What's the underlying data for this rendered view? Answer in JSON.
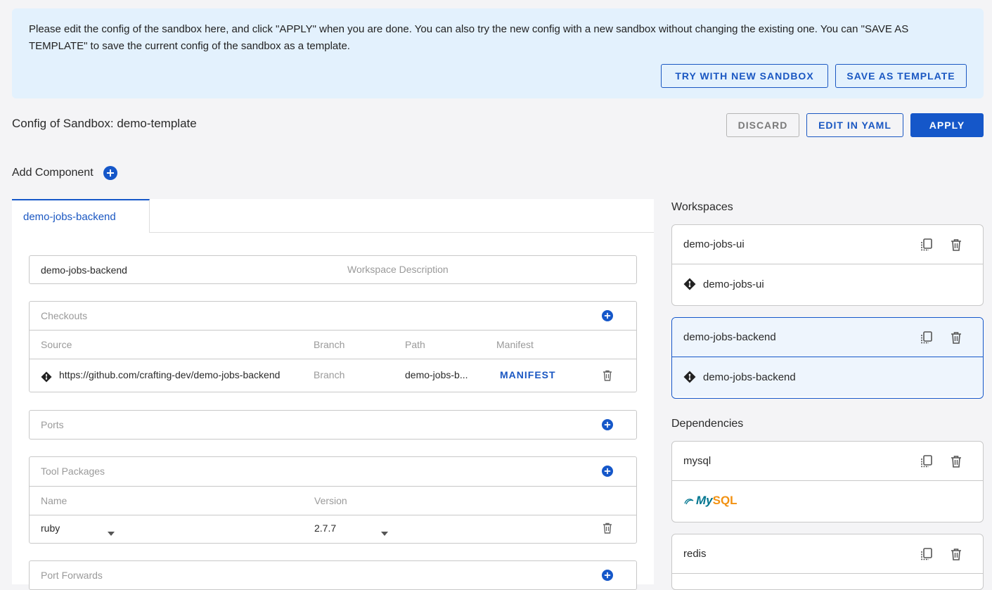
{
  "banner": {
    "text": "Please edit the config of the sandbox here, and click \"APPLY\" when you are done. You can also try the new config with a new sandbox without changing the existing one. You can \"SAVE AS TEMPLATE\" to save the current config of the sandbox as a template.",
    "try_btn": "TRY WITH NEW SANDBOX",
    "save_btn": "SAVE AS TEMPLATE"
  },
  "header": {
    "title": "Config of Sandbox: demo-template",
    "discard": "DISCARD",
    "edit_yaml": "EDIT IN YAML",
    "apply": "APPLY"
  },
  "add_component": "Add Component",
  "tab": {
    "label": "demo-jobs-backend"
  },
  "workspace": {
    "name_value": "demo-jobs-backend",
    "description_placeholder": "Workspace Description"
  },
  "checkouts": {
    "title": "Checkouts",
    "columns": [
      "Source",
      "Branch",
      "Path",
      "Manifest"
    ],
    "row": {
      "source": "https://github.com/crafting-dev/demo-jobs-backend",
      "branch_placeholder": "Branch",
      "path": "demo-jobs-b...",
      "manifest": "MANIFEST"
    }
  },
  "ports": {
    "title": "Ports"
  },
  "tool_packages": {
    "title": "Tool Packages",
    "columns": [
      "Name",
      "Version"
    ],
    "row": {
      "name": "ruby",
      "version": "2.7.7"
    }
  },
  "port_forwards": {
    "title": "Port Forwards"
  },
  "right": {
    "workspaces_title": "Workspaces",
    "workspaces": [
      {
        "name": "demo-jobs-ui",
        "repo": "demo-jobs-ui"
      },
      {
        "name": "demo-jobs-backend",
        "repo": "demo-jobs-backend"
      }
    ],
    "dependencies_title": "Dependencies",
    "dependencies": [
      {
        "name": "mysql",
        "logo": "MySQL"
      },
      {
        "name": "redis"
      }
    ]
  },
  "colors": {
    "accent": "#1557c9",
    "banner_bg": "#e3f1fd",
    "mysql_blue": "#00758f",
    "mysql_orange": "#f29111"
  },
  "icons": {
    "plus": "plus-circle-icon",
    "trash": "trash-icon",
    "copy": "copy-icon",
    "git": "git-icon",
    "chevron": "chevron-down-icon"
  }
}
